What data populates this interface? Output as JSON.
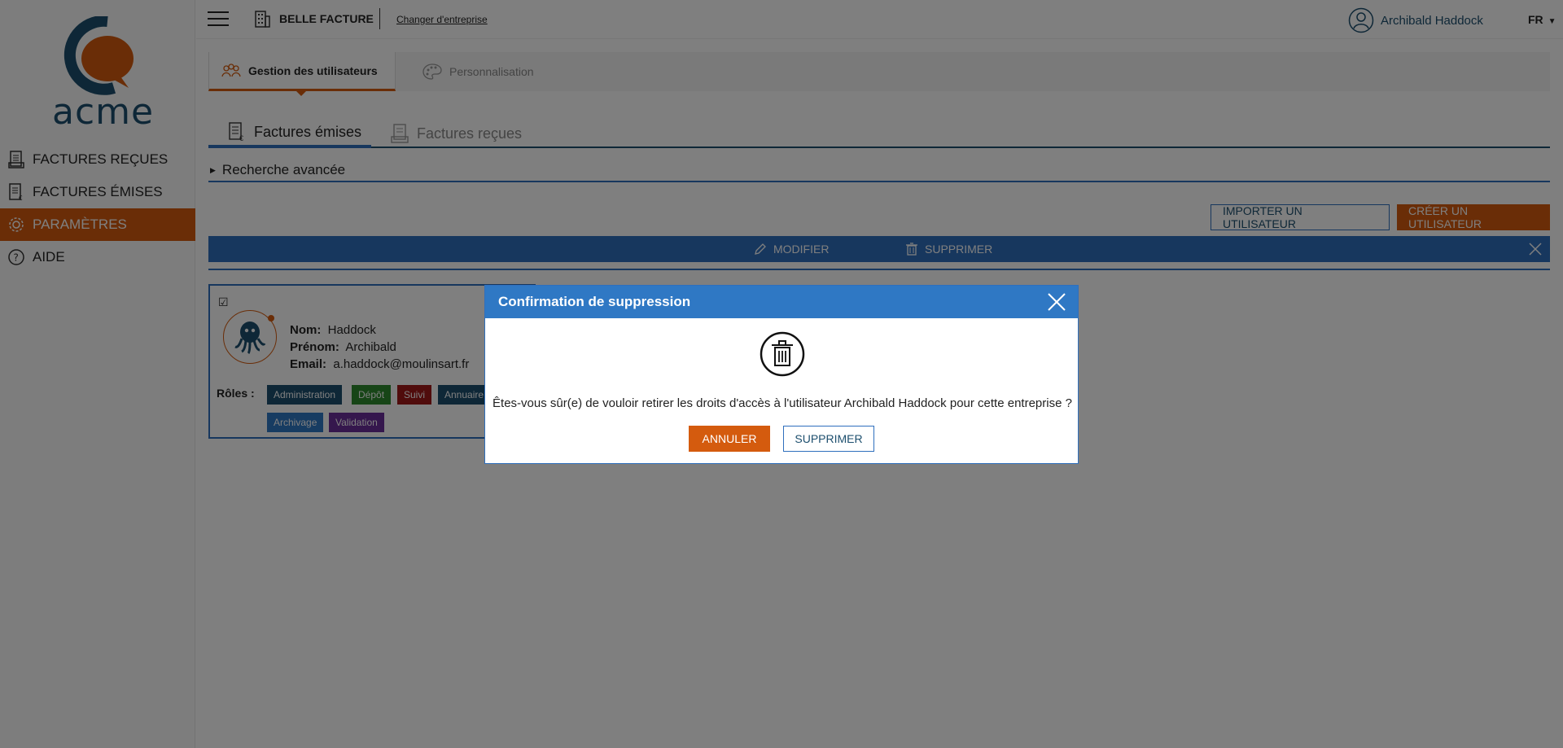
{
  "app": {
    "logo_text": "acme",
    "company_name": "BELLE FACTURE",
    "change_company": "Changer d'entreprise",
    "user_name": "Archibald Haddock",
    "language": "FR"
  },
  "sidebar": {
    "items": [
      {
        "label": "FACTURES REÇUES",
        "icon": "received-invoices-icon"
      },
      {
        "label": "FACTURES ÉMISES",
        "icon": "issued-invoices-icon"
      },
      {
        "label": "PARAMÈTRES",
        "icon": "gear-icon",
        "active": true
      },
      {
        "label": "AIDE",
        "icon": "help-icon"
      }
    ]
  },
  "top_tabs": [
    {
      "label": "Gestion des utilisateurs",
      "active": true
    },
    {
      "label": "Personnalisation",
      "active": false
    }
  ],
  "sub_tabs": [
    {
      "label": "Factures émises",
      "active": true
    },
    {
      "label": "Factures reçues",
      "active": false
    }
  ],
  "advanced_search": "Recherche avancée",
  "buttons": {
    "import_user": "IMPORTER UN UTILISATEUR",
    "create_user": "CRÉER UN UTILISATEUR"
  },
  "action_bar": {
    "modify": "MODIFIER",
    "delete": "SUPPRIMER"
  },
  "user_card": {
    "checkbox": "☑",
    "nom_label": "Nom:",
    "nom": "Haddock",
    "prenom_label": "Prénom:",
    "prenom": "Archibald",
    "email_label": "Email:",
    "email": "a.haddock@moulinsart.fr",
    "roles_label": "Rôles :",
    "roles": [
      {
        "label": "Administration",
        "color": "#1d4f6e"
      },
      {
        "label": "Dépôt",
        "color": "#2e8b2e"
      },
      {
        "label": "Suivi",
        "color": "#a01818"
      },
      {
        "label": "Annuaire",
        "color": "#1d4f6e"
      },
      {
        "label": "Archivage",
        "color": "#2f78c4"
      },
      {
        "label": "Validation",
        "color": "#6a2f9a"
      }
    ]
  },
  "modal": {
    "title": "Confirmation de suppression",
    "message": "Êtes-vous sûr(e) de vouloir retirer les droits d'accès à l'utilisateur Archibald Haddock pour cette entreprise ?",
    "cancel": "ANNULER",
    "confirm": "SUPPRIMER"
  },
  "colors": {
    "accent": "#d45b0e",
    "primary": "#2f6fbd",
    "dark_blue": "#1d4f6e"
  }
}
